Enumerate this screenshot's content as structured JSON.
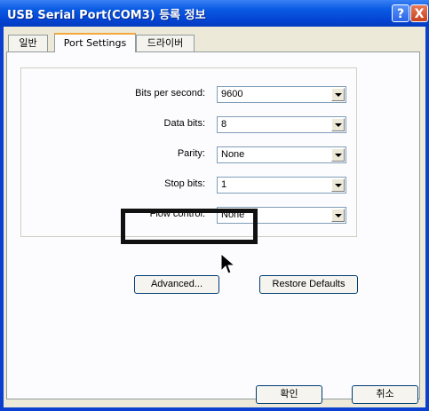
{
  "window": {
    "title": "USB Serial Port(COM3) 등록 정보",
    "help_label": "?",
    "close_label": "X"
  },
  "tabs": [
    {
      "label": "일반",
      "active": false
    },
    {
      "label": "Port Settings",
      "active": true
    },
    {
      "label": "드라이버",
      "active": false
    }
  ],
  "settings": {
    "bits_per_second": {
      "label": "Bits per second:",
      "value": "9600"
    },
    "data_bits": {
      "label": "Data bits:",
      "value": "8"
    },
    "parity": {
      "label": "Parity:",
      "value": "None"
    },
    "stop_bits": {
      "label": "Stop bits:",
      "value": "1"
    },
    "flow_control": {
      "label": "Flow control:",
      "value": "None"
    }
  },
  "buttons": {
    "advanced": "Advanced...",
    "restore_defaults": "Restore Defaults",
    "ok": "확인",
    "cancel": "취소"
  }
}
